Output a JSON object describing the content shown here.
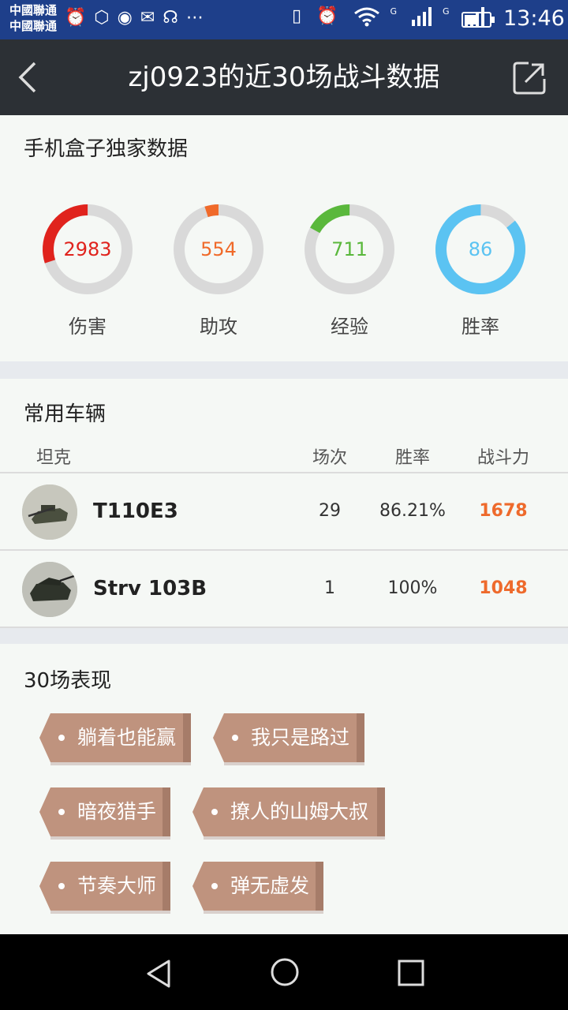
{
  "status_bar": {
    "carrier_1": "中國聯通",
    "carrier_2": "中國聯通",
    "time": "13:46",
    "battery_level": 0.45,
    "left_icons": [
      "alarm-icon",
      "hexagon-icon",
      "chat-bubble-icon",
      "wechat-icon",
      "headset-icon",
      "more-dots-icon"
    ],
    "right_icons": [
      "vibrate-icon",
      "alarm-icon",
      "wifi-icon",
      "signal-icon",
      "signal-icon",
      "battery-icon"
    ],
    "network_1": "G",
    "network_2": "G"
  },
  "header": {
    "title": "zj0923的近30场战斗数据",
    "back_icon": "chevron-left-icon",
    "share_icon": "share-external-icon"
  },
  "exclusive": {
    "title": "手机盒子独家数据",
    "gauges": [
      {
        "value": "2983",
        "label": "伤害",
        "fraction": 0.3,
        "color": "#e0231d"
      },
      {
        "value": "554",
        "label": "助攻",
        "fraction": 0.05,
        "color": "#f06a2a"
      },
      {
        "value": "711",
        "label": "经验",
        "fraction": 0.17,
        "color": "#5ab83c"
      },
      {
        "value": "86",
        "label": "胜率",
        "fraction": 0.86,
        "color": "#5bc3f2"
      }
    ]
  },
  "vehicles": {
    "title": "常用车辆",
    "headers": {
      "tank": "坦克",
      "battles": "场次",
      "winrate": "胜率",
      "power": "战斗力"
    },
    "rows": [
      {
        "name": "T110E3",
        "battles": "29",
        "winrate": "86.21%",
        "power": "1678"
      },
      {
        "name": "Strv 103B",
        "battles": "1",
        "winrate": "100%",
        "power": "1048"
      }
    ]
  },
  "performance": {
    "title": "30场表现",
    "tags": [
      "躺着也能赢",
      "我只是路过",
      "暗夜猎手",
      "撩人的山姆大叔",
      "节奏大师",
      "弹无虚发"
    ]
  },
  "nav": {
    "icons": [
      "back-triangle-icon",
      "home-circle-icon",
      "recents-square-icon"
    ]
  },
  "colors": {
    "header_bg": "#2c3035",
    "status_bg": "#1e3f8a",
    "power": "#ee6a2c",
    "tag": "#bf937e"
  }
}
